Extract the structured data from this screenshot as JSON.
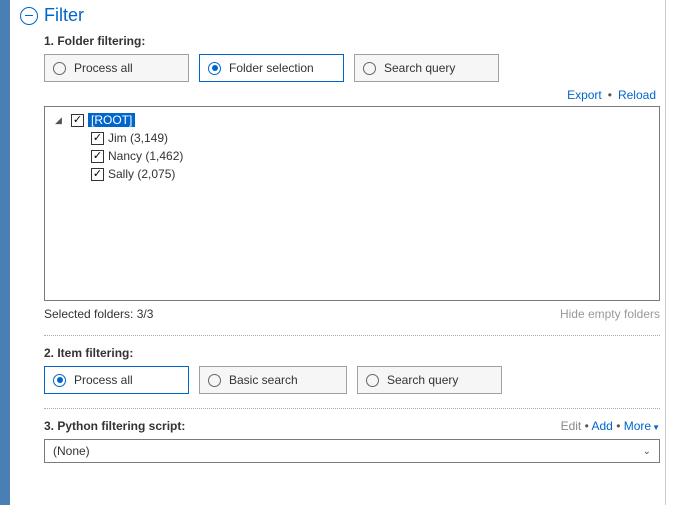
{
  "header": {
    "title": "Filter"
  },
  "folder_filtering": {
    "label": "1. Folder filtering:",
    "options": [
      {
        "label": "Process all",
        "selected": false
      },
      {
        "label": "Folder selection",
        "selected": true
      },
      {
        "label": "Search query",
        "selected": false
      }
    ],
    "links": {
      "export": "Export",
      "reload": "Reload"
    },
    "tree": {
      "root_label": "[ROOT]",
      "children": [
        {
          "label": "Jim (3,149)"
        },
        {
          "label": "Nancy (1,462)"
        },
        {
          "label": "Sally (2,075)"
        }
      ]
    },
    "status": {
      "selected_text": "Selected folders: 3/3",
      "hide_empty": "Hide empty folders"
    }
  },
  "item_filtering": {
    "label": "2. Item filtering:",
    "options": [
      {
        "label": "Process all",
        "selected": true
      },
      {
        "label": "Basic search",
        "selected": false
      },
      {
        "label": "Search query",
        "selected": false
      }
    ]
  },
  "python_filtering": {
    "label": "3. Python filtering script:",
    "links": {
      "edit": "Edit",
      "add": "Add",
      "more": "More"
    },
    "dropdown_value": "(None)"
  }
}
